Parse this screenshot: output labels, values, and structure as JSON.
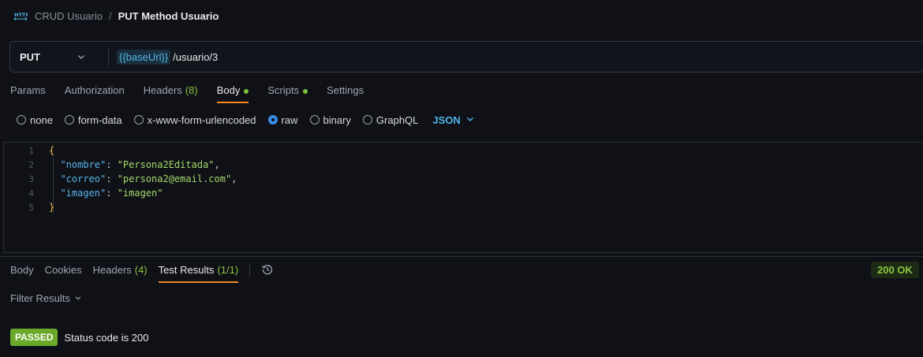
{
  "breadcrumb": {
    "icon": "http-icon",
    "parent": "CRUD Usuario",
    "separator": "/",
    "current": "PUT Method Usuario"
  },
  "request": {
    "method": "PUT",
    "url_variable": "{{baseUrl}}",
    "url_path": "/usuario/3"
  },
  "request_tabs": [
    {
      "label": "Params"
    },
    {
      "label": "Authorization"
    },
    {
      "label": "Headers",
      "count": "(8)"
    },
    {
      "label": "Body",
      "active": true,
      "dot": true
    },
    {
      "label": "Scripts",
      "dot": true
    },
    {
      "label": "Settings"
    }
  ],
  "body_types": {
    "options": [
      "none",
      "form-data",
      "x-www-form-urlencoded",
      "raw",
      "binary",
      "GraphQL"
    ],
    "selected": "raw",
    "language": "JSON"
  },
  "editor": {
    "line_numbers": [
      "1",
      "2",
      "3",
      "4",
      "5"
    ],
    "fields": [
      {
        "key": "\"nombre\"",
        "value": "\"Persona2Editada\""
      },
      {
        "key": "\"correo\"",
        "value": "\"persona2@email.com\""
      },
      {
        "key": "\"imagen\"",
        "value": "\"imagen\""
      }
    ],
    "open_brace": "{",
    "close_brace": "}"
  },
  "response_tabs": [
    {
      "label": "Body"
    },
    {
      "label": "Cookies"
    },
    {
      "label": "Headers",
      "count": "(4)"
    },
    {
      "label": "Test Results",
      "count": "(1/1)",
      "active": true
    }
  ],
  "status": "200 OK",
  "filter_label": "Filter Results",
  "test_results": [
    {
      "status": "PASSED",
      "name": "Status code is 200"
    }
  ],
  "colors": {
    "background": "#0f1117",
    "accent_tab": "#f08a24",
    "success": "#8cc63f",
    "variable": "#52b6e8"
  }
}
